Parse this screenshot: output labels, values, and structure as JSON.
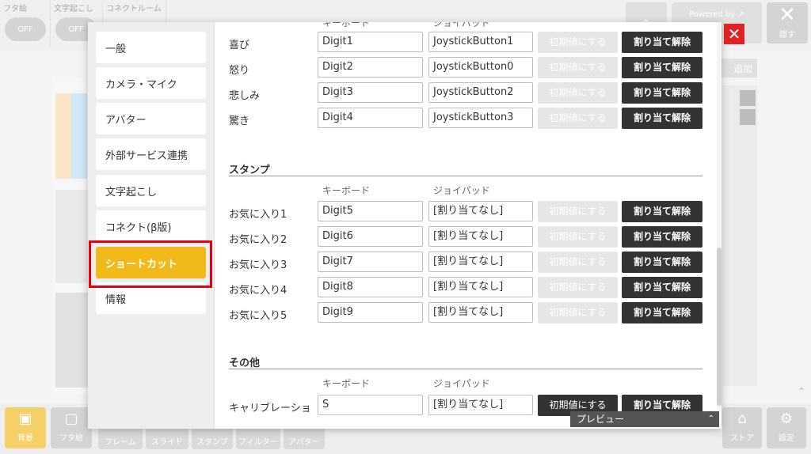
{
  "background": {
    "toggles": [
      {
        "label": "フタ絵",
        "state": "OFF"
      },
      {
        "label": "文字起こし",
        "state": "OFF"
      },
      {
        "label": "コネクトルーム",
        "state": ""
      }
    ],
    "powered_by": "Powered by",
    "hide_label": "隠す",
    "add_label": "追加",
    "toolbar": [
      {
        "label": "背景"
      },
      {
        "label": "フタ絵"
      },
      {
        "label": "フレーム"
      },
      {
        "label": "スライド"
      },
      {
        "label": "スタンプ"
      },
      {
        "label": "フィルター"
      },
      {
        "label": "アバター"
      }
    ],
    "store_label": "ストア",
    "settings_label": "設定"
  },
  "settings": {
    "sidebar": [
      {
        "label": "一般"
      },
      {
        "label": "カメラ・マイク"
      },
      {
        "label": "アバター"
      },
      {
        "label": "外部サービス連携"
      },
      {
        "label": "文字起こし"
      },
      {
        "label": "コネクト(β版)"
      },
      {
        "label": "ショートカット",
        "active": true
      },
      {
        "label": "情報"
      }
    ],
    "reset_label": "初期値にする",
    "unassign_label": "割り当て解除",
    "col_keyboard": "キーボード",
    "col_joypad": "ジョイパッド",
    "expressions": [
      {
        "label": "喜び",
        "keyboard": "Digit1",
        "joypad": "JoystickButton1"
      },
      {
        "label": "怒り",
        "keyboard": "Digit2",
        "joypad": "JoystickButton0"
      },
      {
        "label": "悲しみ",
        "keyboard": "Digit3",
        "joypad": "JoystickButton2"
      },
      {
        "label": "驚き",
        "keyboard": "Digit4",
        "joypad": "JoystickButton3"
      }
    ],
    "stamp_section": {
      "title": "スタンプ",
      "rows": [
        {
          "label": "お気に入り1",
          "keyboard": "Digit5",
          "joypad": "[割り当てなし]"
        },
        {
          "label": "お気に入り2",
          "keyboard": "Digit6",
          "joypad": "[割り当てなし]"
        },
        {
          "label": "お気に入り3",
          "keyboard": "Digit7",
          "joypad": "[割り当てなし]"
        },
        {
          "label": "お気に入り4",
          "keyboard": "Digit8",
          "joypad": "[割り当てなし]"
        },
        {
          "label": "お気に入り5",
          "keyboard": "Digit9",
          "joypad": "[割り当てなし]"
        }
      ]
    },
    "other_section": {
      "title": "その他",
      "rows": [
        {
          "label": "キャリブレーショ",
          "keyboard": "S",
          "joypad": "[割り当てなし]"
        }
      ]
    },
    "preview_label": "プレビュー"
  },
  "colors": {
    "accent": "#f1b919",
    "close": "#e02222",
    "dark_button": "#333333",
    "highlight_box": "#e60012"
  }
}
